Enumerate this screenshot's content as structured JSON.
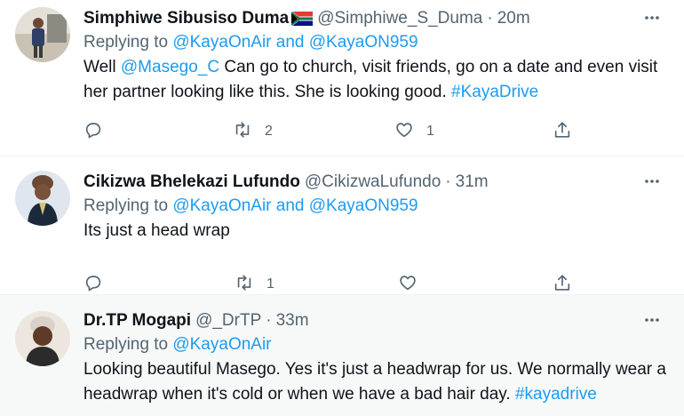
{
  "tweets": [
    {
      "name": "Simphiwe Sibusiso Duma",
      "handle": "@Simphiwe_S_Duma",
      "dot": "·",
      "time": "20m",
      "replying_prefix": "Replying to",
      "replying_to": "@KayaOnAir and @KayaON959",
      "text_parts": [
        "Well ",
        "@Masego_C",
        " Can go to church, visit friends, go on a date and even visit her partner looking like this. She is looking good. ",
        "#KayaDrive"
      ],
      "retweets": "2",
      "likes": "1"
    },
    {
      "name": "Cikizwa Bhelekazi Lufundo",
      "handle": "@CikizwaLufundo",
      "dot": "·",
      "time": "31m",
      "replying_prefix": "Replying to",
      "replying_to": "@KayaOnAir and @KayaON959",
      "text": "Its just a head wrap",
      "retweets": "1"
    },
    {
      "name": "Dr.TP Mogapi",
      "handle": "@_DrTP",
      "dot": "·",
      "time": "33m",
      "replying_prefix": "Replying to",
      "replying_to": "@KayaOnAir",
      "text_parts": [
        "Looking beautiful Masego. Yes it's just a headwrap for us. We normally wear a headwrap when it's cold or when we have a bad hair day. ",
        "#kayadrive"
      ]
    }
  ],
  "icons": {
    "more": "more-icon",
    "reply": "reply-icon",
    "retweet": "retweet-icon",
    "like": "heart-icon",
    "share": "share-icon"
  },
  "colors": {
    "link": "#1d9bf0",
    "muted": "#536471",
    "text": "#0f1419",
    "highlight_bg": "#f7f9f9"
  }
}
